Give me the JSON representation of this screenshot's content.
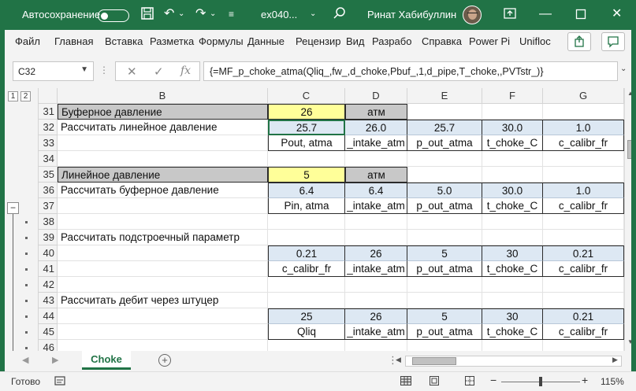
{
  "titlebar": {
    "autosave_label": "Автосохранение",
    "autosave_state": "off",
    "filename": "ex040...",
    "user_name": "Ринат Хабибуллин",
    "bg_color": "#217346"
  },
  "ribbon": {
    "tabs": [
      "Файл",
      "Главная",
      "Вставка",
      "Разметка",
      "Формулы",
      "Данные",
      "Рецензир",
      "Вид",
      "Разрабо",
      "Справка",
      "Power Pi",
      "Unifloc"
    ]
  },
  "formula_bar": {
    "name_box": "C32",
    "formula": "{=MF_p_choke_atma(Qliq_,fw_,d_choke,Pbuf_,1,d_pipe,T_choke,,PVTstr_)}"
  },
  "outline_levels": [
    "1",
    "2"
  ],
  "columns": [
    "B",
    "C",
    "D",
    "E",
    "F",
    "G"
  ],
  "rows": [
    {
      "num": "31",
      "cells": {
        "B": "Буферное давление",
        "C": "26",
        "D": "атм",
        "E": "",
        "F": "",
        "G": ""
      }
    },
    {
      "num": "32",
      "cells": {
        "B": "Рассчитать линейное давление",
        "C": "25.7",
        "D": "26.0",
        "E": "25.7",
        "F": "30.0",
        "G": "1.0"
      }
    },
    {
      "num": "33",
      "cells": {
        "B": "",
        "C": "Pout, atma",
        "D": "_intake_atm",
        "E": "p_out_atma",
        "F": "t_choke_C",
        "G": "c_calibr_fr"
      }
    },
    {
      "num": "34",
      "cells": {
        "B": "",
        "C": "",
        "D": "",
        "E": "",
        "F": "",
        "G": ""
      }
    },
    {
      "num": "35",
      "cells": {
        "B": "Линейное давление",
        "C": "5",
        "D": "атм",
        "E": "",
        "F": "",
        "G": ""
      }
    },
    {
      "num": "36",
      "cells": {
        "B": "Рассчитать буферное давление",
        "C": "6.4",
        "D": "6.4",
        "E": "5.0",
        "F": "30.0",
        "G": "1.0"
      }
    },
    {
      "num": "37",
      "cells": {
        "B": "",
        "C": "Pin, atma",
        "D": "_intake_atm",
        "E": "p_out_atma",
        "F": "t_choke_C",
        "G": "c_calibr_fr"
      }
    },
    {
      "num": "38",
      "cells": {
        "B": "",
        "C": "",
        "D": "",
        "E": "",
        "F": "",
        "G": ""
      }
    },
    {
      "num": "39",
      "cells": {
        "B": "Рассчитать подстроечный параметр",
        "C": "",
        "D": "",
        "E": "",
        "F": "",
        "G": ""
      }
    },
    {
      "num": "40",
      "cells": {
        "B": "",
        "C": "0.21",
        "D": "26",
        "E": "5",
        "F": "30",
        "G": "0.21"
      }
    },
    {
      "num": "41",
      "cells": {
        "B": "",
        "C": "c_calibr_fr",
        "D": "_intake_atm",
        "E": "p_out_atma",
        "F": "t_choke_C",
        "G": "c_calibr_fr"
      }
    },
    {
      "num": "42",
      "cells": {
        "B": "",
        "C": "",
        "D": "",
        "E": "",
        "F": "",
        "G": ""
      }
    },
    {
      "num": "43",
      "cells": {
        "B": "Рассчитать дебит через штуцер",
        "C": "",
        "D": "",
        "E": "",
        "F": "",
        "G": ""
      }
    },
    {
      "num": "44",
      "cells": {
        "B": "",
        "C": "25",
        "D": "26",
        "E": "5",
        "F": "30",
        "G": "0.21"
      }
    },
    {
      "num": "45",
      "cells": {
        "B": "",
        "C": "Qliq",
        "D": "_intake_atm",
        "E": "p_out_atma",
        "F": "t_choke_C",
        "G": "c_calibr_fr"
      }
    },
    {
      "num": "46",
      "cells": {
        "B": "",
        "C": "",
        "D": "",
        "E": "",
        "F": "",
        "G": ""
      }
    }
  ],
  "sheet_tabs": [
    "Choke"
  ],
  "status": {
    "ready": "Готово",
    "zoom": "115%"
  }
}
